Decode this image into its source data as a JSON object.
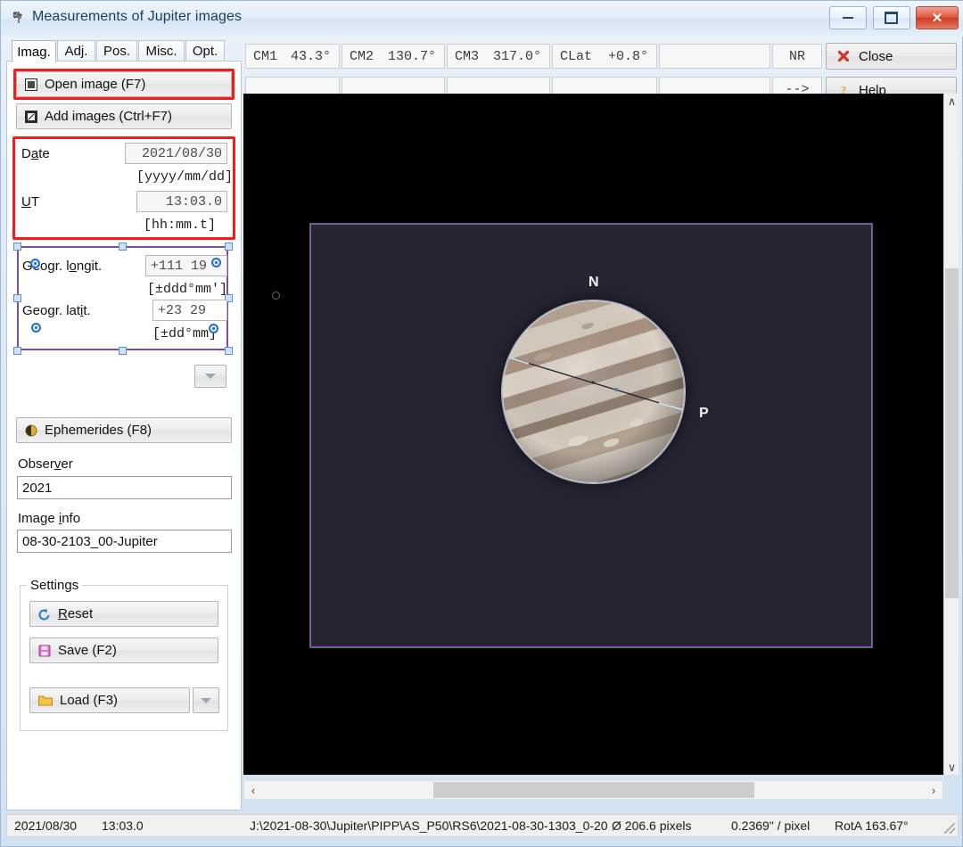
{
  "window": {
    "title": "Measurements of Jupiter images",
    "icon": "app-icon",
    "minimize_label": "",
    "maximize_label": "",
    "close_label": "✕"
  },
  "tabs": [
    {
      "label": "Imag.",
      "active": true
    },
    {
      "label": "Adj.",
      "active": false
    },
    {
      "label": "Pos.",
      "active": false
    },
    {
      "label": "Misc.",
      "active": false
    },
    {
      "label": "Opt.",
      "active": false
    }
  ],
  "left_panel": {
    "open_image_button": "Open image (F7)",
    "add_images_button": "Add images (Ctrl+F7)",
    "date_label": "Date",
    "date_value": "2021/08/30",
    "date_format": "[yyyy/mm/dd]",
    "ut_label": "UT",
    "ut_value": "13:03.0",
    "ut_format": "[hh:mm.t]",
    "longitude_label": "Geogr. longit.",
    "longitude_value": "+111 19",
    "longitude_format": "[±ddd°mm']",
    "latitude_label": "Geogr. latit.",
    "latitude_value": "+23 29",
    "latitude_format": "[±dd°mm]",
    "ephemerides_button": "Ephemerides (F8)",
    "observer_label": "Observer",
    "observer_value": "2021",
    "image_info_label": "Image info",
    "image_info_value": "08-30-2103_00-Jupiter",
    "settings_group_title": "Settings",
    "reset_button": "Reset",
    "save_button": "Save (F2)",
    "load_button": "Load (F3)"
  },
  "info_row_1": [
    {
      "key": "CM1",
      "value": "43.3°"
    },
    {
      "key": "CM2",
      "value": "130.7°"
    },
    {
      "key": "CM3",
      "value": "317.0°"
    },
    {
      "key": "CLat",
      "value": "+0.8°"
    },
    {
      "key": "",
      "value": ""
    },
    {
      "key": "",
      "value": "NR"
    }
  ],
  "info_row_2": [
    {
      "key": "",
      "value": ""
    },
    {
      "key": "",
      "value": ""
    },
    {
      "key": "",
      "value": ""
    },
    {
      "key": "",
      "value": ""
    },
    {
      "key": "",
      "value": ""
    },
    {
      "key": "",
      "value": "-->"
    }
  ],
  "actions": {
    "close_button": "Close",
    "help_button": "Help"
  },
  "canvas": {
    "north_label": "N",
    "preceding_label": "P",
    "background_color": "#000000",
    "frame_background": "#262433",
    "frame_border_color": "#9b4fd0",
    "frame_outer_color": "#2e7d4f"
  },
  "scrollbars": {
    "up_arrow": "∧",
    "down_arrow": "∨",
    "left_arrow": "‹",
    "right_arrow": "›"
  },
  "status_bar": {
    "date": "2021/08/30",
    "time": "13:03.0",
    "file_path": "J:\\2021-08-30\\Jupiter\\PIPP\\AS_P50\\RS6\\2021-08-30-1303_0-20",
    "diameter": "Ø 206.6 pixels",
    "scale": "0.2369\" / pixel",
    "rotation": "RotA 163.67°"
  }
}
